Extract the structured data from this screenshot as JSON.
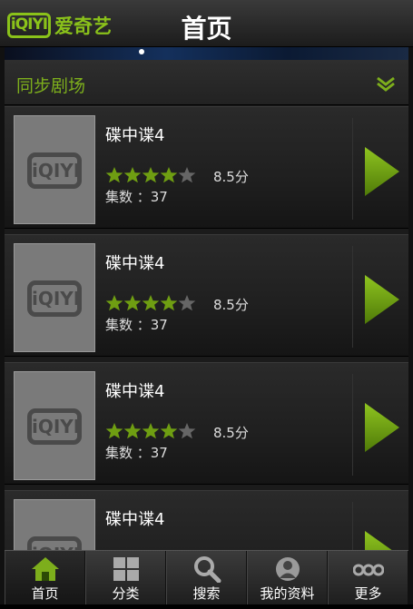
{
  "header": {
    "logo_box": "iQIYI",
    "logo_text": "爱奇艺",
    "title": "首页"
  },
  "section": {
    "title": "同步剧场",
    "collapse_icon": "double-chevron-down-icon"
  },
  "cards": [
    {
      "title": "碟中谍4",
      "rating_stars": 4,
      "max_stars": 5,
      "score": "8.5分",
      "episodes": "集数 ：37",
      "thumb_logo": "iQIYI"
    },
    {
      "title": "碟中谍4",
      "rating_stars": 4,
      "max_stars": 5,
      "score": "8.5分",
      "episodes": "集数 ：37",
      "thumb_logo": "iQIYI"
    },
    {
      "title": "碟中谍4",
      "rating_stars": 4,
      "max_stars": 5,
      "score": "8.5分",
      "episodes": "集数 ：37",
      "thumb_logo": "iQIYI"
    },
    {
      "title": "碟中谍4",
      "thumb_logo": "iQIYI"
    }
  ],
  "nav": [
    {
      "label": "首页",
      "icon": "home-icon",
      "active": true
    },
    {
      "label": "分类",
      "icon": "grid-icon",
      "active": false
    },
    {
      "label": "搜索",
      "icon": "search-icon",
      "active": false
    },
    {
      "label": "我的资料",
      "icon": "user-icon",
      "active": false
    },
    {
      "label": "更多",
      "icon": "more-icon",
      "active": false
    }
  ],
  "colors": {
    "accent_green": "#7dae1c",
    "star_filled": "#6f9e12",
    "star_empty": "#666666",
    "play_green": "#6a9e10"
  }
}
